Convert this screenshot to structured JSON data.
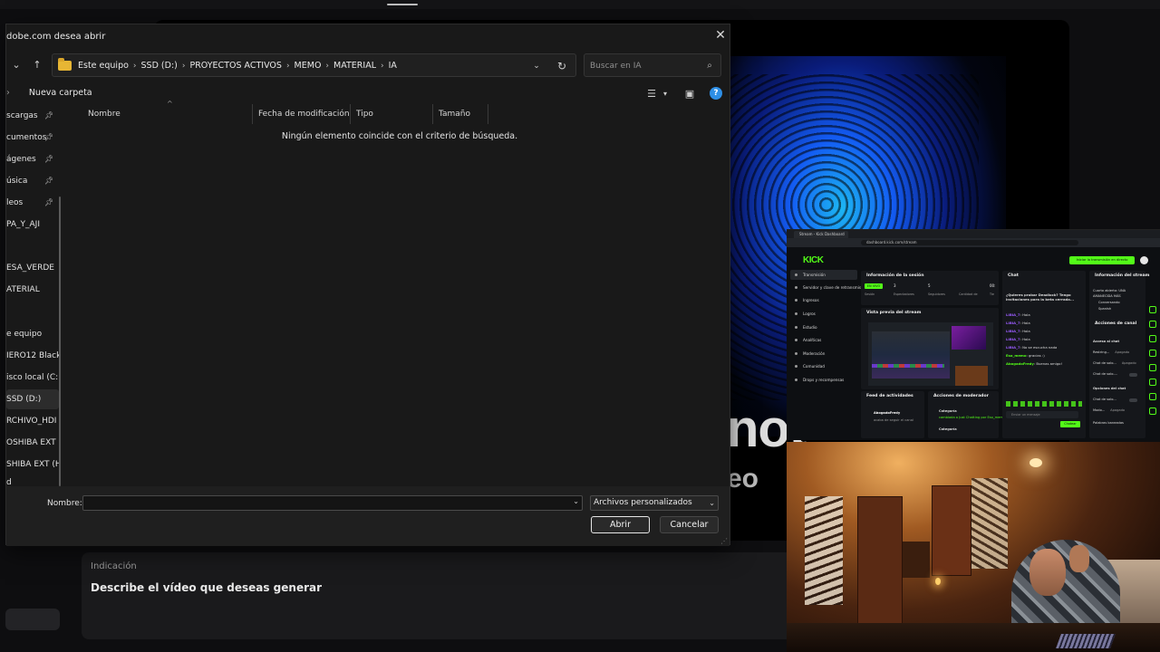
{
  "dialog": {
    "title": "dobe.com desea abrir",
    "breadcrumbs": [
      "Este equipo",
      "SSD (D:)",
      "PROYECTOS ACTIVOS",
      "MEMO",
      "MATERIAL",
      "IA"
    ],
    "search_placeholder": "Buscar en IA",
    "new_folder_label": "Nueva carpeta",
    "sidebar": [
      {
        "label": "scargas",
        "pinned": true
      },
      {
        "label": "cumentos",
        "pinned": true
      },
      {
        "label": "ágenes",
        "pinned": true
      },
      {
        "label": "úsica",
        "pinned": true
      },
      {
        "label": "leos",
        "pinned": true
      },
      {
        "label": "PA_Y_AJI",
        "pinned": false
      },
      {
        "label": "",
        "pinned": false
      },
      {
        "label": "ESA_VERDE",
        "pinned": false
      },
      {
        "label": "ATERIAL",
        "pinned": false
      },
      {
        "label": "",
        "pinned": false
      },
      {
        "label": "e equipo",
        "pinned": false
      },
      {
        "label": "IERO12 Black",
        "pinned": false
      },
      {
        "label": "isco local (C:",
        "pinned": false
      },
      {
        "label": "SSD (D:)",
        "pinned": false,
        "active": true
      },
      {
        "label": "RCHIVO_HDI",
        "pinned": false
      },
      {
        "label": "OSHIBA EXT (",
        "pinned": false
      },
      {
        "label": "SHIBA EXT (H",
        "pinned": false
      },
      {
        "label": "d",
        "pinned": false
      }
    ],
    "columns": [
      "Nombre",
      "Fecha de modificación",
      "Tipo",
      "Tamaño"
    ],
    "empty_message": "Ningún elemento coincide con el criterio de búsqueda.",
    "name_label": "Nombre:",
    "name_value": "",
    "file_type_filter": "Archivos personalizados",
    "open_label": "Abrir",
    "cancel_label": "Cancelar"
  },
  "background": {
    "hero_big": "not",
    "hero_small": "eo",
    "prompt_label": "Indicación",
    "prompt_placeholder": "Describe el vídeo que deseas generar"
  },
  "kick": {
    "tab_title": "Stream - Kick Dashboard",
    "url": "dashboard.kick.com/stream",
    "logo": "KICK",
    "live_button": "Iniciar la transmisión en directo",
    "nav": [
      "Transmisión",
      "Servidor y clave de retransmisión",
      "Ingresos",
      "Logros",
      "Estudio",
      "Analíticas",
      "Moderación",
      "Comunidad",
      "Drops y recompensas"
    ],
    "session_title": "Información de la sesión",
    "session_badge": "EN VIVO",
    "session_stats": [
      {
        "num": "3",
        "label": "Espectadores"
      },
      {
        "num": "5",
        "label": "Seguidores"
      },
      {
        "num": "",
        "label": "Cantidad de"
      },
      {
        "num": "00:",
        "label": "Tie"
      }
    ],
    "session_first_label": "Sesión",
    "preview_title": "Vista previa del stream",
    "chat_title": "Chat",
    "chat_pinned": "¿Quieres probar Deadlock? Tengo invitaciones para la beta cerrada...",
    "chat_messages": [
      {
        "user": "LIBIA_7",
        "text": "Hola"
      },
      {
        "user": "LIBIA_7",
        "text": "Hola"
      },
      {
        "user": "LIBIA_7",
        "text": "Hola"
      },
      {
        "user": "LIBIA_7",
        "text": "Hola"
      },
      {
        "user": "LIBIA_7",
        "text": "No se escucha nada"
      },
      {
        "user": "Eso_memo",
        "text": "gracias :)"
      },
      {
        "user": "AbogadoFredy",
        "text": "Buenas amigo!"
      }
    ],
    "chat_input_placeholder": "Enviar un mensaje",
    "chat_send": "Chatear",
    "stream_info_title": "Información del stream",
    "stream_info_lines": [
      "Cuarto abierto: UNA",
      "AMANECIDA MÁS",
      "Conversando",
      "Spanish"
    ],
    "channel_actions_title": "Acciones de canal",
    "channel_actions": [
      {
        "label": "Acceso al chat",
        "value": ""
      },
      {
        "label": "Restring...",
        "value": "Apagado"
      },
      {
        "label": "Chat de solo...",
        "value": "Apagado"
      },
      {
        "label": "Chat de solo-...",
        "value": ""
      },
      {
        "label": "Opciones del chat",
        "value": ""
      },
      {
        "label": "Chat de solo...",
        "value": ""
      },
      {
        "label": "Modo...",
        "value": "Apagado"
      },
      {
        "label": "Palabras baneadas",
        "value": ""
      }
    ],
    "activity_title": "Feed de actividades",
    "activity_user": "AbogadoFredy",
    "activity_text": "acaba de seguir el canal",
    "mod_title": "Acciones de moderador",
    "mod_items": [
      {
        "label": "Categoría",
        "detail": "cambiada a Just Chatting por Eso_memo"
      },
      {
        "label": "Categoría",
        "detail": ""
      }
    ]
  }
}
